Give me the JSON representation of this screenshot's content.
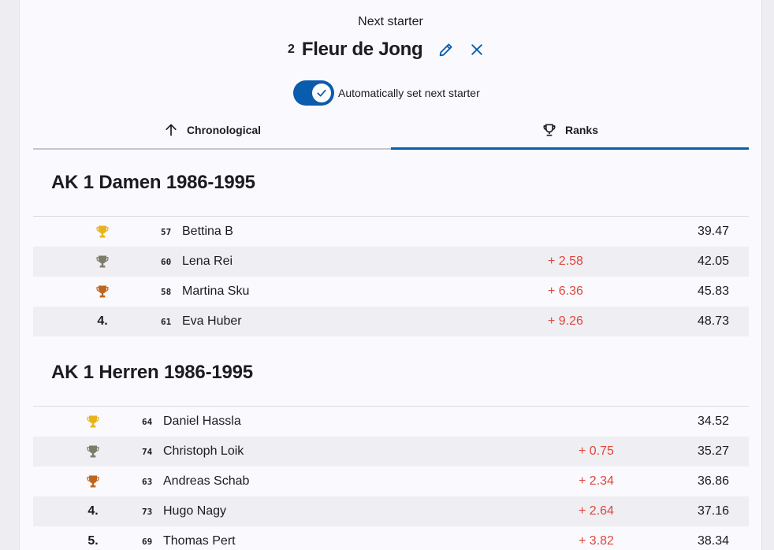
{
  "header": {
    "next_label": "Next starter",
    "starter_number": "2",
    "starter_name": "Fleur de Jong",
    "edit_icon": "pencil-icon",
    "close_icon": "close-icon"
  },
  "auto_toggle": {
    "on": true,
    "label": "Automatically set next starter"
  },
  "tabs": [
    {
      "label": "Chronological",
      "icon": "arrow-up-icon",
      "active": false
    },
    {
      "label": "Ranks",
      "icon": "trophy-icon",
      "active": true
    }
  ],
  "colors": {
    "accent": "#0a5cad",
    "gold": "#e9b31d",
    "silver": "#7d7c6a",
    "bronze": "#c0651f",
    "diff_red": "#e0463b"
  },
  "sections": [
    {
      "title": "AK 1 Damen 1986-1995",
      "rows": [
        {
          "rank": "",
          "medal": "gold",
          "bib": "57",
          "name": "Bettina B",
          "diff": "",
          "time": "39.47"
        },
        {
          "rank": "",
          "medal": "silver",
          "bib": "60",
          "name": "Lena Rei",
          "diff": "+ 2.58",
          "time": "42.05"
        },
        {
          "rank": "",
          "medal": "bronze",
          "bib": "58",
          "name": "Martina Sku",
          "diff": "+ 6.36",
          "time": "45.83"
        },
        {
          "rank": "4.",
          "medal": "",
          "bib": "61",
          "name": "Eva Huber",
          "diff": "+ 9.26",
          "time": "48.73"
        }
      ]
    },
    {
      "title": "AK 1 Herren 1986-1995",
      "rows": [
        {
          "rank": "",
          "medal": "gold",
          "bib": "64",
          "name": "Daniel Hassla",
          "diff": "",
          "time": "34.52"
        },
        {
          "rank": "",
          "medal": "silver",
          "bib": "74",
          "name": "Christoph Loik",
          "diff": "+ 0.75",
          "time": "35.27"
        },
        {
          "rank": "",
          "medal": "bronze",
          "bib": "63",
          "name": "Andreas Schab",
          "diff": "+ 2.34",
          "time": "36.86"
        },
        {
          "rank": "4.",
          "medal": "",
          "bib": "73",
          "name": "Hugo Nagy",
          "diff": "+ 2.64",
          "time": "37.16"
        },
        {
          "rank": "5.",
          "medal": "",
          "bib": "69",
          "name": "Thomas Pert",
          "diff": "+ 3.82",
          "time": "38.34"
        }
      ]
    }
  ]
}
